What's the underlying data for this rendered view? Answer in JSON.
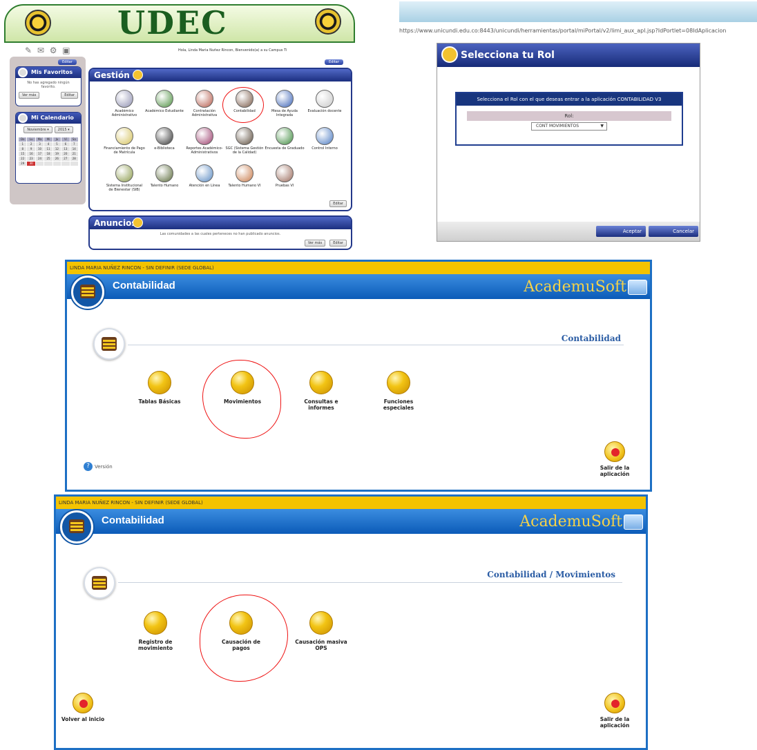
{
  "portal": {
    "logo_text": "UDEC",
    "welcome": "Hola, Linda Maria Nuñez Rincon, Bienvenido(a) a su Campus Ti",
    "favorites_title": "Mis Favoritos",
    "favorites_empty": "No has agregado ningún favorito.",
    "see_more": "Ver más",
    "edit": "Editar",
    "calendar_title": "Mi Calendario",
    "calendar_month": "Noviembre",
    "calendar_year": "2015",
    "calendar_days": [
      "Do",
      "Lu",
      "Ma",
      "Mi",
      "Ju",
      "Vi",
      "Sa",
      "1",
      "2",
      "3",
      "4",
      "5",
      "6",
      "7",
      "8",
      "9",
      "10",
      "11",
      "12",
      "13",
      "14",
      "15",
      "16",
      "17",
      "18",
      "19",
      "20",
      "21",
      "22",
      "23",
      "24",
      "25",
      "26",
      "27",
      "28",
      "29",
      "30",
      "",
      "",
      "",
      "",
      ""
    ],
    "calendar_selected": "30",
    "gestion_title": "Gestión",
    "anuncios_title": "Anuncios",
    "anuncios_text": "Las comunidades a las cuales perteneces no han publicado anuncios.",
    "apps": [
      {
        "label": "Académico Administrativo"
      },
      {
        "label": "Académico Estudiante"
      },
      {
        "label": "Contratación Administrativa"
      },
      {
        "label": "Contabilidad"
      },
      {
        "label": "Mesa de Ayuda Integrada"
      },
      {
        "label": "Evaluación docente"
      },
      {
        "label": "Financiamiento de Pago de Matrícula"
      },
      {
        "label": "e-Biblioteca"
      },
      {
        "label": "Reportes Académico-Administrativos"
      },
      {
        "label": "SGC (Sistema Gestión de la Calidad)"
      },
      {
        "label": "Encuesta de Graduado"
      },
      {
        "label": "Control Interno"
      },
      {
        "label": "Sistema Institucional de Bienestar (SIB)"
      },
      {
        "label": "Talento Humano"
      },
      {
        "label": "Atención en Línea"
      },
      {
        "label": "Talento Humano VI"
      },
      {
        "label": "Pruebas VI"
      }
    ]
  },
  "role_dialog": {
    "url": "https://www.unicundi.edu.co:8443/unicundi/herramientas/portal/miPortal/v2/limi_aux_apl.jsp?IdPortlet=08IdAplicacion",
    "title": "Selecciona tu Rol",
    "prompt": "Selecciona el Rol con el que deseas entrar a la aplicación CONTABILIDAD V3",
    "role_label": "Rol:",
    "role_value": "CONT MOVIMIENTOS",
    "accept_label": "Aceptar",
    "cancel_label": "Cancelar"
  },
  "acad1": {
    "user_bar": "LINDA MARIA NUÑEZ RINCON - SIN DEFINIR (SEDE GLOBAL)",
    "app_title": "Contabilidad",
    "brand": "AcademuSoft",
    "section": "Contabilidad",
    "modules": [
      {
        "label": "Tablas Básicas"
      },
      {
        "label": "Movimientos"
      },
      {
        "label": "Consultas e informes"
      },
      {
        "label": "Funciones especiales"
      }
    ],
    "version_label": "Versión",
    "exit_label": "Salir de la aplicación"
  },
  "acad2": {
    "user_bar": "LINDA MARIA NUÑEZ RINCON - SIN DEFINIR (SEDE GLOBAL)",
    "app_title": "Contabilidad",
    "brand": "AcademuSoft",
    "section": "Contabilidad / Movimientos",
    "modules": [
      {
        "label": "Registro de movimiento"
      },
      {
        "label": "Causación de pagos"
      },
      {
        "label": "Causación masiva OPS"
      }
    ],
    "back_label": "Volver al inicio",
    "exit_label": "Salir de la aplicación"
  },
  "colors": {
    "academusoft_blue": "#1d6fc4",
    "user_bar_yellow": "#f4c300",
    "portal_green": "#1b5e20",
    "highlight_red": "#e11111"
  }
}
